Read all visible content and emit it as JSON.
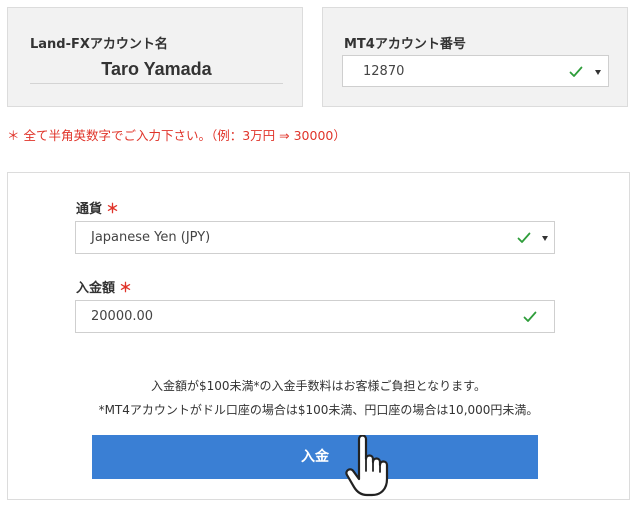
{
  "account_name": {
    "label": "Land-FXアカウント名",
    "value": "Taro Yamada"
  },
  "mt4_account": {
    "label": "MT4アカウント番号",
    "selected": "12870",
    "status_icon": "check-icon"
  },
  "note": "＊ 全て半角英数字でご入力下さい。（例：3万円 ⇒ 30000）",
  "form": {
    "currency_label": "通貨",
    "currency_required": "＊",
    "currency_selected": "Japanese Yen (JPY)",
    "amount_label": "入金額",
    "amount_required": "＊",
    "amount_value": "20000.00",
    "info_line1": "入金額が$100未満*の入金手数料はお客様ご負担となります。",
    "info_line2": "*MT4アカウントがドル口座の場合は$100未満、円口座の場合は10,000円未満。",
    "submit_label": "入金"
  },
  "colors": {
    "accent": "#3a7fd4",
    "check": "#2e9d3a",
    "required": "#e0342a"
  }
}
